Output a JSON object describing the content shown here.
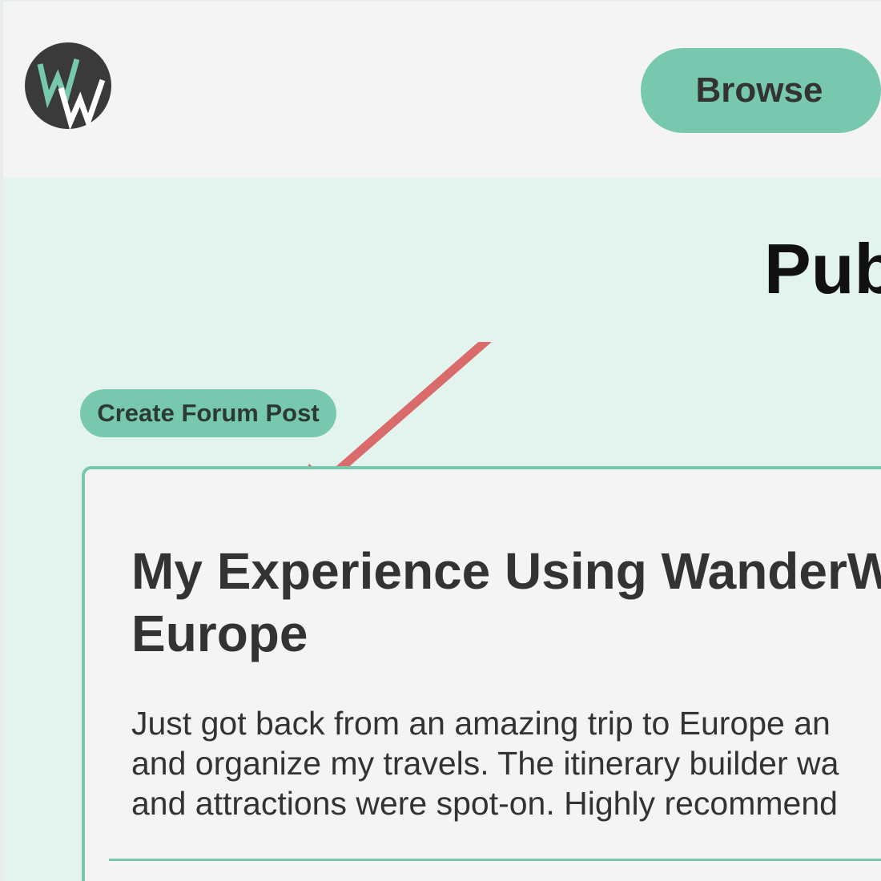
{
  "header": {
    "logo_text": "WW",
    "browse_label": "Browse"
  },
  "main": {
    "page_title": "Pub",
    "create_post_label": "Create Forum Post"
  },
  "post": {
    "title": "My Experience Using WanderW\nEurope",
    "body": "Just got back from an amazing trip to Europe an\nand organize my travels. The itinerary builder wa\nand attractions were spot-on. Highly recommend"
  },
  "colors": {
    "accent": "#77c8ae",
    "main_background": "#e3f3ed",
    "page_background": "#f4f4f4",
    "arrow": "#d96b6b",
    "logo_dark": "#3a3a3a"
  },
  "icons": {
    "logo": "wanderw-logo-icon",
    "annotation": "red-arrow-icon"
  }
}
